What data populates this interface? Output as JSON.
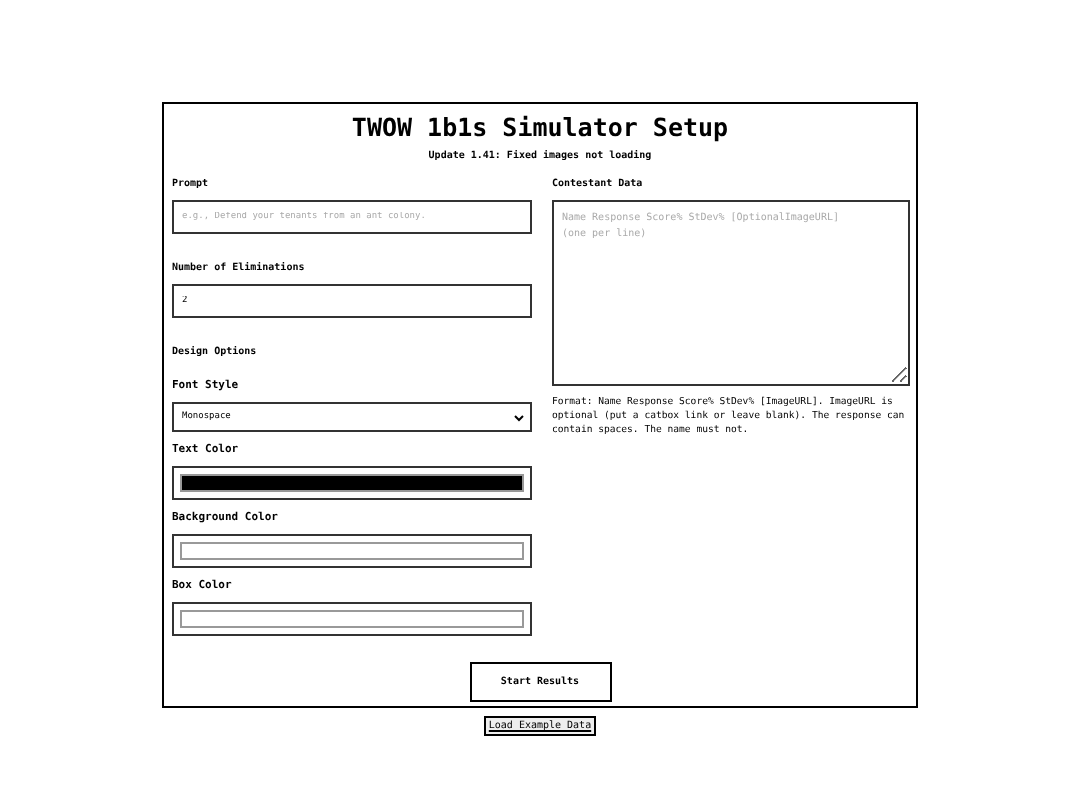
{
  "title": "TWOW 1b1s Simulator Setup",
  "subtitle": "Update 1.41: Fixed images not loading",
  "prompt": {
    "label": "Prompt",
    "placeholder": "e.g., Defend your tenants from an ant colony."
  },
  "eliminations": {
    "label": "Number of Eliminations",
    "value": "2"
  },
  "design": {
    "heading": "Design Options",
    "font_style": {
      "label": "Font Style",
      "value": "Monospace"
    },
    "colors": [
      {
        "label": "Text Color",
        "color": "#000000"
      },
      {
        "label": "Background Color",
        "color": "#ffffff"
      },
      {
        "label": "Box Color",
        "color": "#ffffff"
      }
    ]
  },
  "contestant_data": {
    "label": "Contestant Data",
    "placeholder": "Name Response Score% StDev% [OptionalImageURL]\n(one per line)",
    "help": "Format: Name Response Score% StDev% [ImageURL]. ImageURL is optional (put a catbox link or leave blank). The response can contain spaces. The name must not."
  },
  "buttons": {
    "start": "Start Results",
    "example": "Load Example Data"
  }
}
